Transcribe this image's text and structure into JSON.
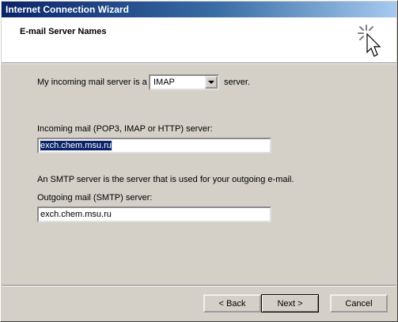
{
  "window": {
    "title": "Internet Connection Wizard"
  },
  "header": {
    "title": "E-mail Server Names",
    "icon": "wizard-sparkle-cursor-icon"
  },
  "incoming_type": {
    "prefix": "My incoming mail server is a",
    "selected": "IMAP",
    "suffix": "server."
  },
  "incoming": {
    "label": "Incoming mail (POP3, IMAP or HTTP) server:",
    "value": "exch.chem.msu.ru"
  },
  "smtp_note": "An SMTP server is the server that is used for your outgoing e-mail.",
  "outgoing": {
    "label": "Outgoing mail (SMTP) server:",
    "value": "exch.chem.msu.ru"
  },
  "buttons": {
    "back": "< Back",
    "next": "Next >",
    "cancel": "Cancel"
  }
}
